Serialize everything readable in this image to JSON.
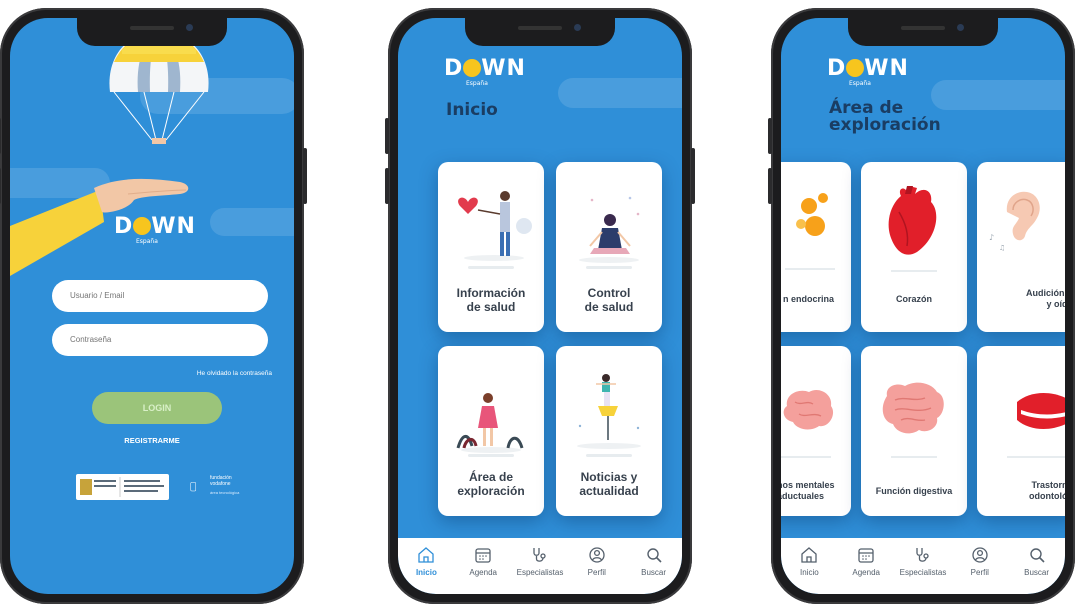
{
  "login": {
    "logo_main_left": "D",
    "logo_main_right": "WN",
    "logo_sub": "España",
    "username_placeholder": "Usuario / Email",
    "password_placeholder": "Contraseña",
    "forgot_password": "He olvidado la contraseña",
    "login_button": "LOGIN",
    "register_link": "REGISTRARME",
    "foundation_text": "fundación vodafone",
    "foundation_sub": "área tecnológica"
  },
  "home": {
    "title": "Inicio",
    "cards": [
      {
        "line1": "Información",
        "line2": "de salud"
      },
      {
        "line1": "Control",
        "line2": "de salud"
      },
      {
        "line1": "Área de",
        "line2": "exploración"
      },
      {
        "line1": "Noticias y",
        "line2": "actualidad"
      }
    ]
  },
  "exploration": {
    "title_line1": "Área de",
    "title_line2": "exploración",
    "cards_row1": [
      {
        "label": "n endocrina"
      },
      {
        "label": "Corazón"
      },
      {
        "label_line1": "Audición, r",
        "label_line2": "y oído"
      }
    ],
    "cards_row2": [
      {
        "label_line1": "nos mentales",
        "label_line2": "aductuales"
      },
      {
        "label": "Función digestiva"
      },
      {
        "label_line1": "Trastorno",
        "label_line2": "odontológ"
      }
    ]
  },
  "tabbar": {
    "items": [
      "Inicio",
      "Agenda",
      "Especialistas",
      "Perfil",
      "Buscar"
    ],
    "active_home": "Inicio"
  },
  "colors": {
    "background_blue": "#2f8fd8",
    "title_navy": "#1a3d63",
    "logo_yellow": "#f7c51e",
    "login_green": "#9bc47a"
  },
  "icons": [
    "home-icon",
    "calendar-icon",
    "stethoscope-icon",
    "profile-icon",
    "search-icon"
  ]
}
